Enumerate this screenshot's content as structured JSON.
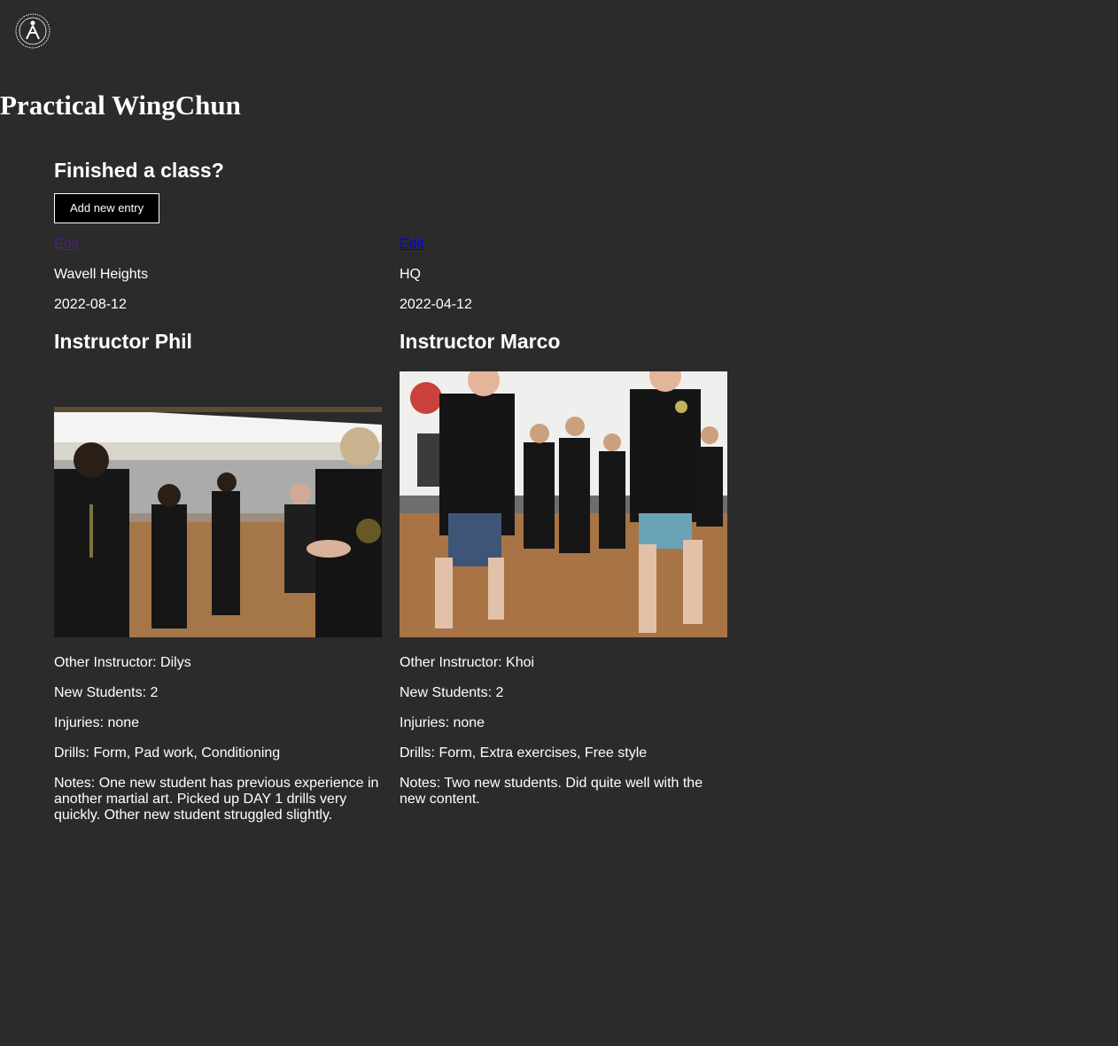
{
  "site": {
    "title": "Practical WingChun",
    "logo_icon": "wingchun-logo-icon"
  },
  "main": {
    "heading": "Finished a class?",
    "add_button_label": "Add new entry"
  },
  "entries": [
    {
      "edit_label": "Edit",
      "location": "Wavell Heights",
      "date": "2022-08-12",
      "instructor": "Instructor Phil",
      "other_instructor": "Other Instructor: Dilys",
      "new_students": "New Students: 2",
      "injuries": "Injuries: none",
      "drills": "Drills: Form, Pad work, Conditioning",
      "notes": "Notes: One new student has previous experience in another martial art. Picked up DAY 1 drills very quickly. Other new student struggled slightly."
    },
    {
      "edit_label": "Edit",
      "location": "HQ",
      "date": "2022-04-12",
      "instructor": "Instructor Marco",
      "other_instructor": "Other Instructor: Khoi",
      "new_students": "New Students: 2",
      "injuries": "Injuries: none",
      "drills": "Drills: Form, Extra exercises, Free style",
      "notes": "Notes: Two new students. Did quite well with the new content."
    }
  ],
  "colors": {
    "background": "#2b2b2b",
    "text": "#ffffff",
    "link_visited": "#551a8b",
    "link": "#0000ee",
    "button_bg": "#000000"
  }
}
